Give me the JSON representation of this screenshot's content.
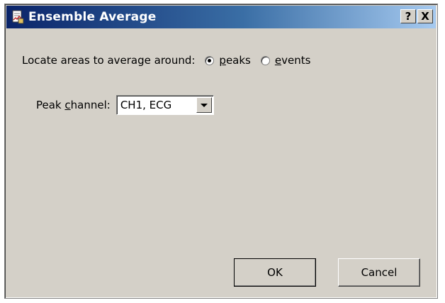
{
  "window": {
    "title": "Ensemble Average",
    "help_button": "?",
    "close_button": "X"
  },
  "locate": {
    "label": "Locate areas to average around:",
    "options": [
      {
        "label_underline": "p",
        "label_rest": "eaks",
        "label": "peaks",
        "checked": true
      },
      {
        "label_underline": "e",
        "label_rest": "vents",
        "label": "events",
        "checked": false
      }
    ]
  },
  "peak_channel": {
    "label_pre": "Peak ",
    "label_underline": "c",
    "label_rest": "hannel:",
    "label": "Peak channel:",
    "value": "CH1, ECG"
  },
  "buttons": {
    "ok": "OK",
    "cancel": "Cancel"
  },
  "icons": {
    "title_icon": "document-chart-icon",
    "dropdown_icon": "chevron-down-icon"
  },
  "colors": {
    "titlebar_start": "#0a246a",
    "titlebar_end": "#a6caf0",
    "face": "#d4d0c8"
  }
}
